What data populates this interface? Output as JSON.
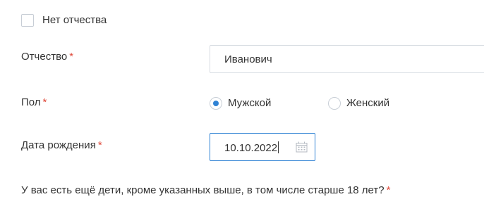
{
  "no_patronymic": {
    "label": "Нет отчества",
    "checked": false
  },
  "patronymic": {
    "label": "Отчество",
    "required_mark": "*",
    "value": "Иванович"
  },
  "gender": {
    "label": "Пол",
    "required_mark": "*",
    "options": [
      {
        "label": "Мужской",
        "checked": true
      },
      {
        "label": "Женский",
        "checked": false
      }
    ]
  },
  "birth_date": {
    "label": "Дата рождения",
    "required_mark": "*",
    "value": "10.10.2022",
    "icon": "calendar-icon"
  },
  "other_children": {
    "question": "У вас есть ещё дети, кроме указанных выше, в том числе старше 18 лет?",
    "required_mark": "*"
  },
  "colors": {
    "accent": "#2f82d4",
    "required": "#e04b3c",
    "text": "#333333",
    "border": "#d7dce2"
  }
}
